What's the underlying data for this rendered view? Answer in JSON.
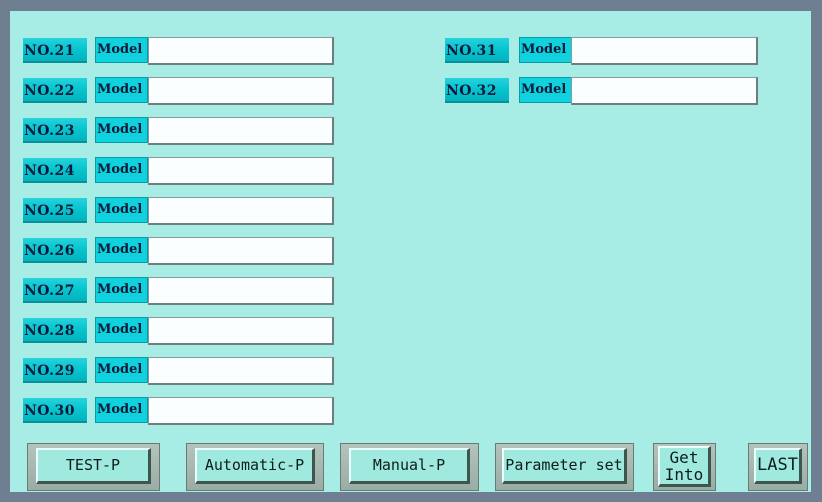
{
  "left_column": [
    {
      "no": "NO.21",
      "model_label": "Model",
      "value": ""
    },
    {
      "no": "NO.22",
      "model_label": "Model",
      "value": ""
    },
    {
      "no": "NO.23",
      "model_label": "Model",
      "value": ""
    },
    {
      "no": "NO.24",
      "model_label": "Model",
      "value": ""
    },
    {
      "no": "NO.25",
      "model_label": "Model",
      "value": ""
    },
    {
      "no": "NO.26",
      "model_label": "Model",
      "value": ""
    },
    {
      "no": "NO.27",
      "model_label": "Model",
      "value": ""
    },
    {
      "no": "NO.28",
      "model_label": "Model",
      "value": ""
    },
    {
      "no": "NO.29",
      "model_label": "Model",
      "value": ""
    },
    {
      "no": "NO.30",
      "model_label": "Model",
      "value": ""
    }
  ],
  "right_column": [
    {
      "no": "NO.31",
      "model_label": "Model",
      "value": ""
    },
    {
      "no": "NO.32",
      "model_label": "Model",
      "value": ""
    }
  ],
  "buttons": {
    "test_p": "TEST-P",
    "automatic_p": "Automatic-P",
    "manual_p": "Manual-P",
    "parameter_set": "Parameter set",
    "get_into": "Get\nInto",
    "last": "LAST"
  },
  "colors": {
    "screen_bg": "#a8ece6",
    "frame": "#6f7f92",
    "label_cyan": "#07c4cf"
  }
}
